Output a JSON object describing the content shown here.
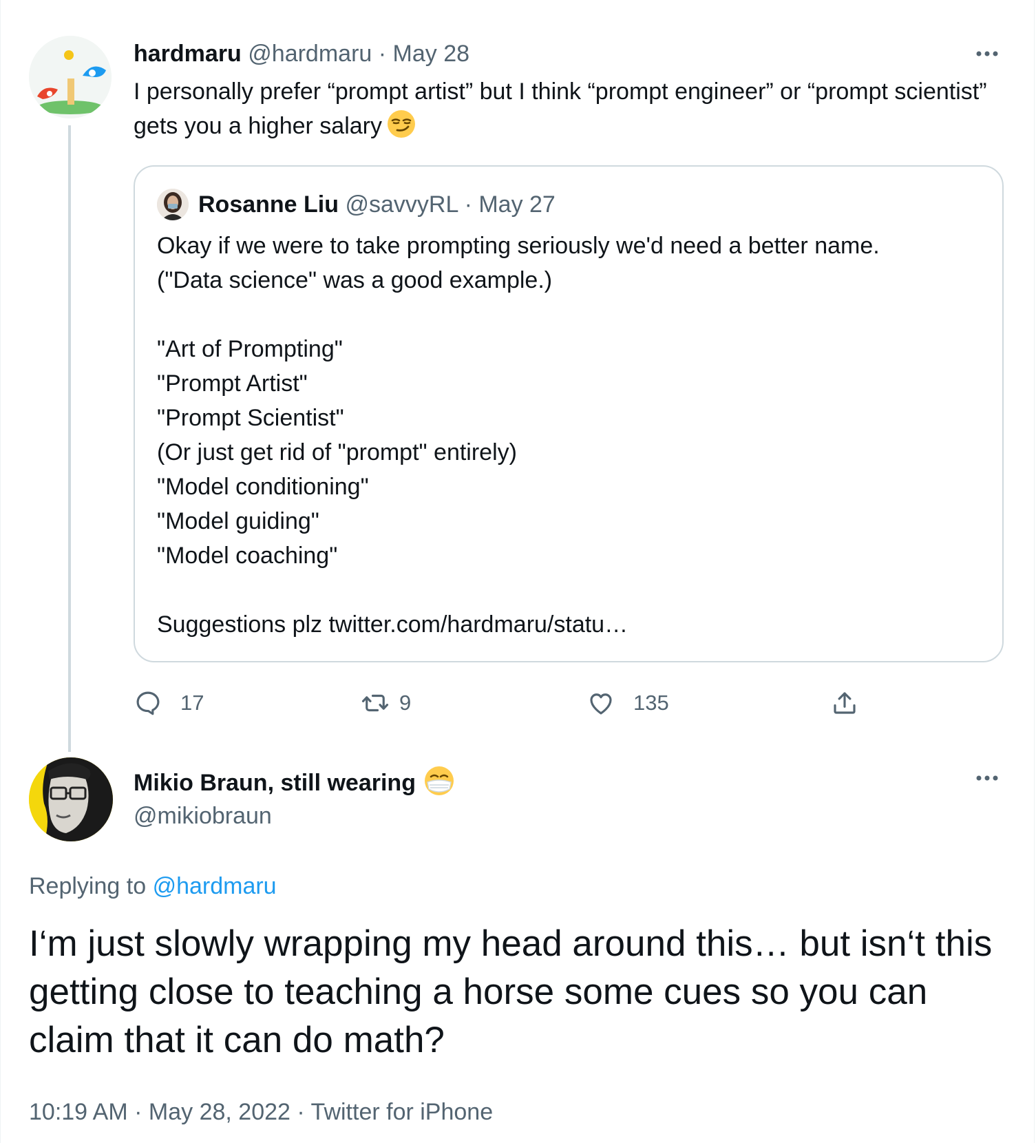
{
  "tweet1": {
    "name": "hardmaru",
    "handle": "@hardmaru",
    "separator": "·",
    "date": "May 28",
    "text": "I personally prefer “prompt artist” but I think “prompt engineer” or “prompt scientist” gets you a higher salary",
    "emoji": "smirking-face",
    "quote": {
      "name": "Rosanne Liu",
      "handle": "@savvyRL",
      "separator": "·",
      "date": "May 27",
      "lines": [
        "Okay if we were to take prompting seriously we'd need a better name.",
        "(\"Data science\" was a good example.)",
        "",
        "\"Art of Prompting\"",
        "\"Prompt Artist\"",
        "\"Prompt Scientist\"",
        "(Or just get rid of \"prompt\" entirely)",
        "\"Model conditioning\"",
        "\"Model guiding\"",
        "\"Model coaching\"",
        "",
        "Suggestions plz twitter.com/hardmaru/statu…"
      ]
    },
    "actions": {
      "replies": "17",
      "retweets": "9",
      "likes": "135"
    }
  },
  "tweet2": {
    "name": "Mikio Braun, still wearing",
    "name_emoji": "face-with-medical-mask",
    "handle": "@mikiobraun",
    "replying_prefix": "Replying to",
    "replying_handle": "@hardmaru",
    "text": "I‘m just slowly wrapping my head around this… but isn‘t this getting close to teaching a horse some cues so you can claim that it can do math?",
    "time": "10:19 AM",
    "separator1": "·",
    "date": "May 28, 2022",
    "separator2": "·",
    "source": "Twitter for iPhone"
  },
  "colors": {
    "text": "#0f1419",
    "muted": "#536471",
    "link": "#1d9bf0",
    "border": "#cfd9de"
  },
  "icons": [
    "more-icon",
    "reply-icon",
    "retweet-icon",
    "like-icon",
    "share-icon"
  ]
}
